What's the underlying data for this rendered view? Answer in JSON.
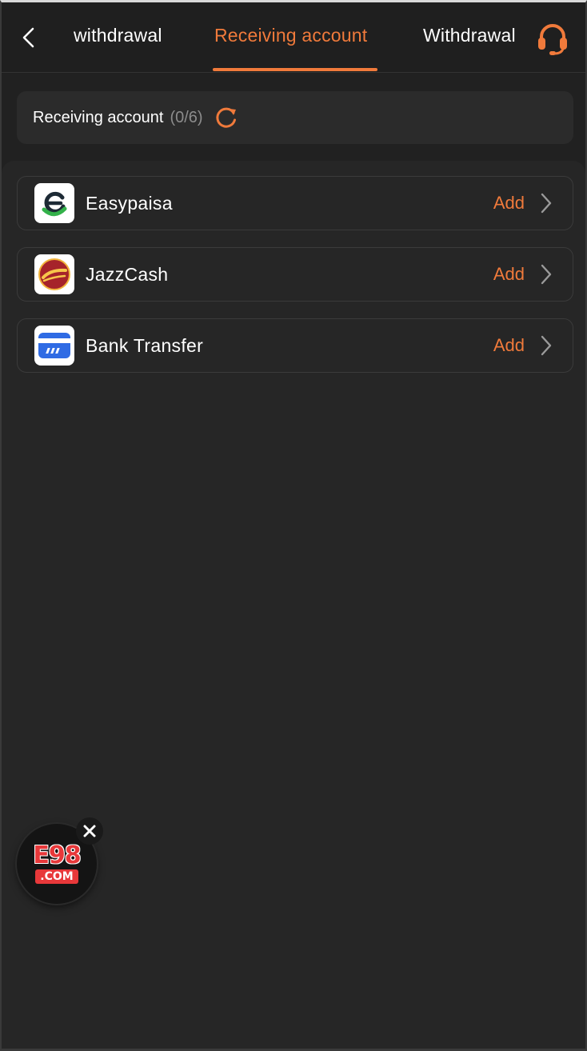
{
  "header": {
    "tabs": [
      {
        "label": "withdrawal",
        "active": false
      },
      {
        "label": "Receiving account",
        "active": true
      },
      {
        "label": "Withdrawal",
        "active": false
      }
    ]
  },
  "summary": {
    "label": "Receiving account",
    "count": "(0/6)"
  },
  "methods": [
    {
      "name": "Easypaisa",
      "action": "Add",
      "icon": "easypaisa-logo"
    },
    {
      "name": "JazzCash",
      "action": "Add",
      "icon": "jazzcash-logo"
    },
    {
      "name": "Bank Transfer",
      "action": "Add",
      "icon": "bank-card-icon"
    }
  ],
  "floating_badge": {
    "main": "E98",
    "sub": ".COM"
  },
  "colors": {
    "accent": "#f07a3b",
    "background": "#212121",
    "panel": "#262626"
  }
}
